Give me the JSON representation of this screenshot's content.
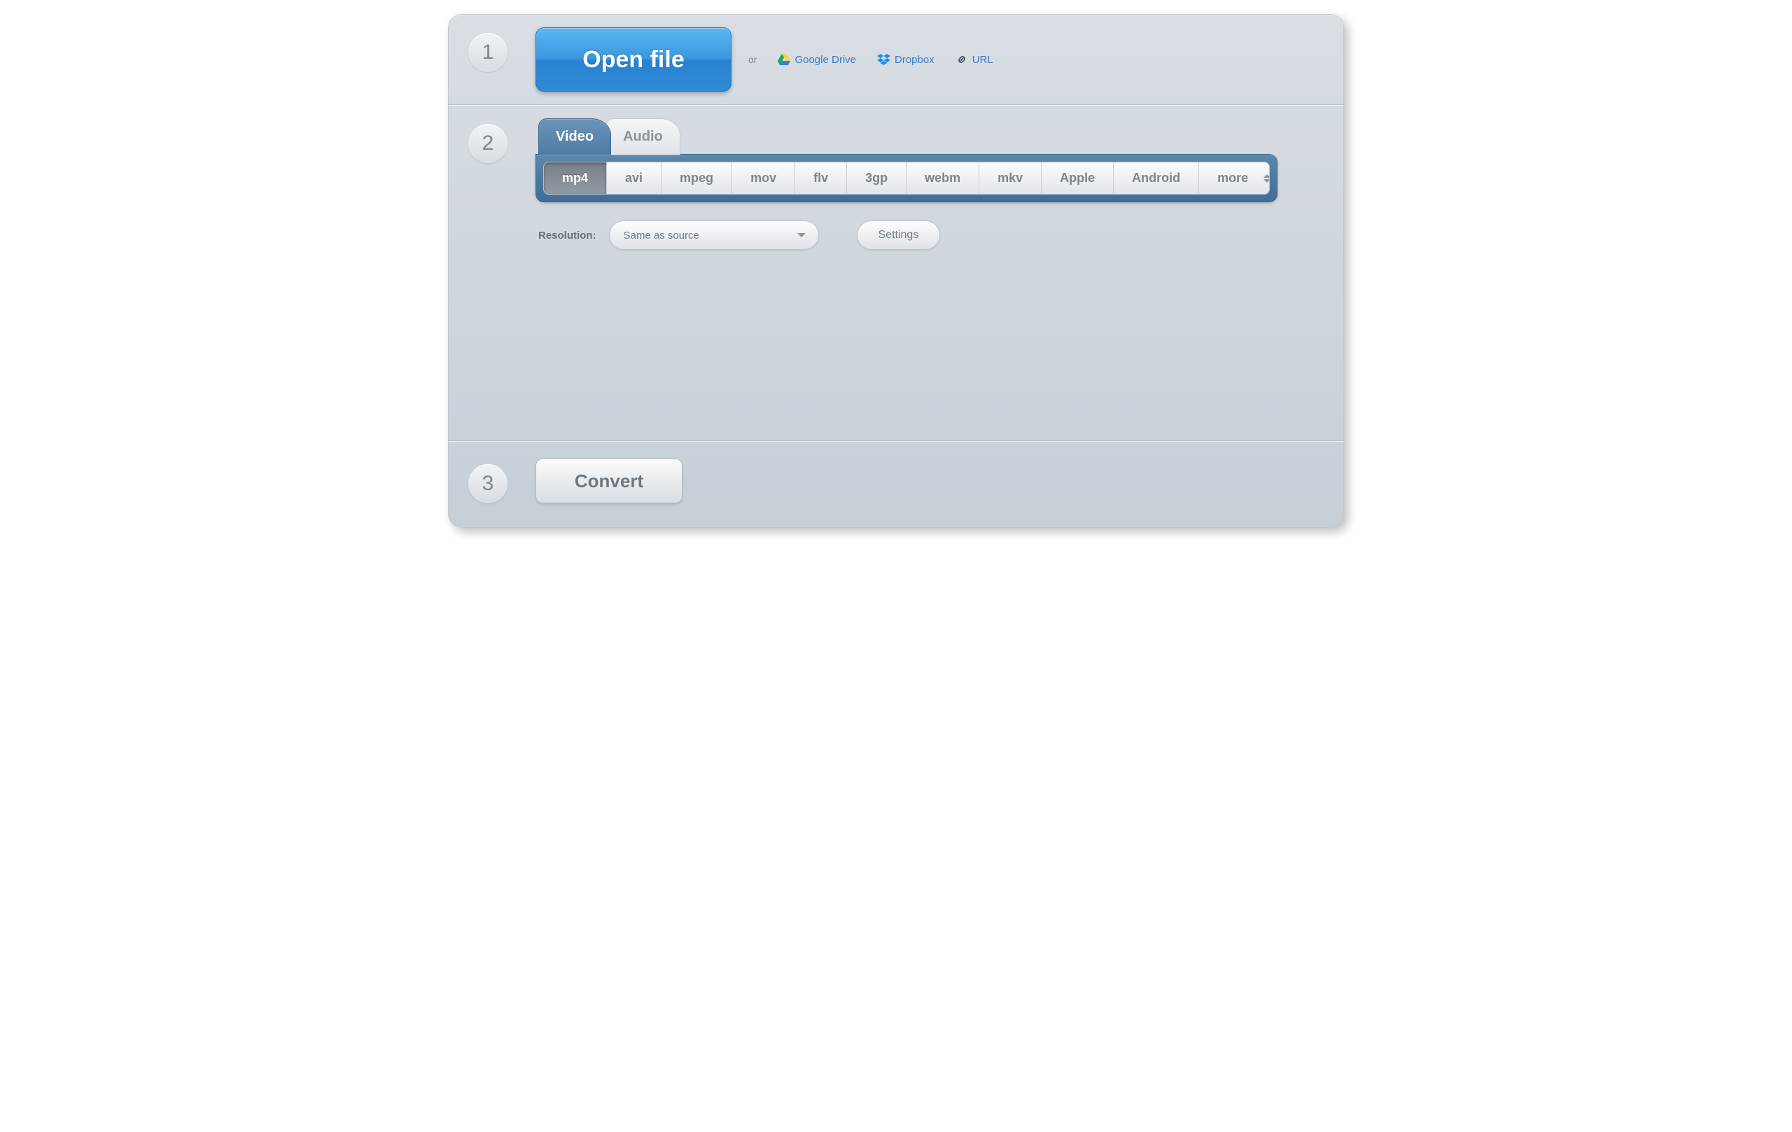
{
  "steps": {
    "s1": "1",
    "s2": "2",
    "s3": "3"
  },
  "open": {
    "button": "Open file",
    "or": "or",
    "sources": {
      "gdrive": "Google Drive",
      "dropbox": "Dropbox",
      "url": "URL"
    }
  },
  "tabs": {
    "video": "Video",
    "audio": "Audio"
  },
  "formats": {
    "mp4": "mp4",
    "avi": "avi",
    "mpeg": "mpeg",
    "mov": "mov",
    "flv": "flv",
    "3gp": "3gp",
    "webm": "webm",
    "mkv": "mkv",
    "apple": "Apple",
    "android": "Android",
    "more": "more"
  },
  "options": {
    "resolution_label": "Resolution:",
    "resolution_value": "Same as source",
    "settings": "Settings"
  },
  "convert": {
    "button": "Convert"
  }
}
